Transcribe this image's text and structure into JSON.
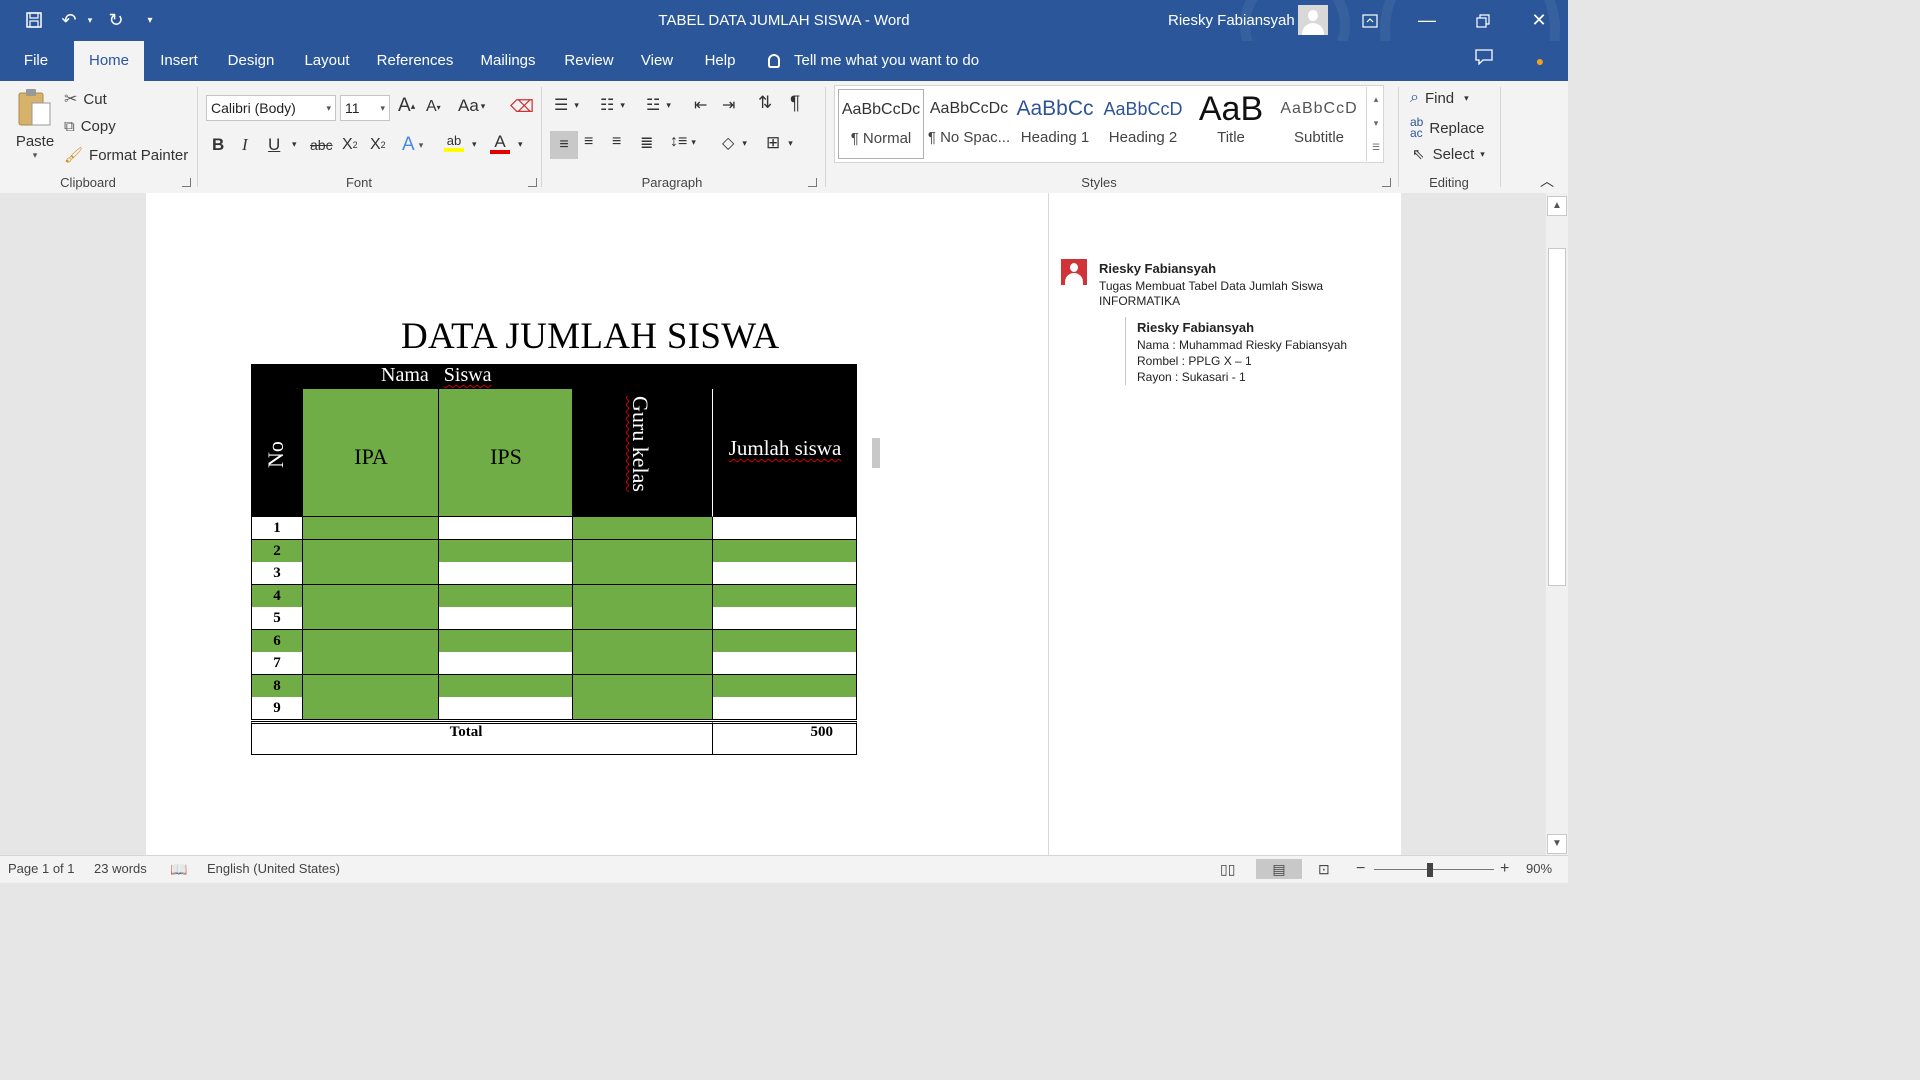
{
  "window": {
    "document_title": "TABEL DATA JUMLAH SISWA  -  Word",
    "user": "Riesky Fabiansyah"
  },
  "tabs": [
    "File",
    "Home",
    "Insert",
    "Design",
    "Layout",
    "References",
    "Mailings",
    "Review",
    "View",
    "Help"
  ],
  "active_tab": "Home",
  "tell_me": "Tell me what you want to do",
  "ribbon": {
    "clipboard": {
      "paste": "Paste",
      "cut": "Cut",
      "copy": "Copy",
      "format_painter": "Format Painter",
      "label": "Clipboard"
    },
    "font": {
      "font_name": "Calibri (Body)",
      "font_size": "11",
      "change_case": "Aa",
      "label": "Font",
      "bold": "B",
      "italic": "I",
      "underline": "U",
      "strikethrough": "abc",
      "subscript": "X2",
      "superscript": "X2",
      "text_effects": "A",
      "font_color": "A"
    },
    "paragraph": {
      "label": "Paragraph"
    },
    "styles": {
      "items": [
        {
          "preview": "AaBbCcDc",
          "name": "¶ Normal"
        },
        {
          "preview": "AaBbCcDc",
          "name": "¶ No Spac..."
        },
        {
          "preview": "AaBbCc",
          "name": "Heading 1"
        },
        {
          "preview": "AaBbCcD",
          "name": "Heading 2"
        },
        {
          "preview": "AaB",
          "name": "Title"
        },
        {
          "preview": "AaBbCcD",
          "name": "Subtitle"
        }
      ],
      "label": "Styles"
    },
    "editing": {
      "find": "Find",
      "replace": "Replace",
      "select": "Select",
      "label": "Editing"
    }
  },
  "document": {
    "heading": "DATA JUMLAH SISWA",
    "table": {
      "header_group": [
        "Nama",
        "Siswa"
      ],
      "col_no": "No",
      "col_ipa": "IPA",
      "col_ips": "IPS",
      "col_guru": "Guru kelas",
      "col_jumlah": "Jumlah siswa",
      "rows": [
        "1",
        "2",
        "3",
        "4",
        "5",
        "6",
        "7",
        "8",
        "9"
      ],
      "total_label": "Total",
      "total_value": "500"
    }
  },
  "comments": [
    {
      "author": "Riesky Fabiansyah",
      "lines": [
        "Tugas Membuat Tabel Data Jumlah Siswa",
        "INFORMATIKA"
      ]
    },
    {
      "author": "Riesky Fabiansyah",
      "lines": [
        "Nama : Muhammad Riesky Fabiansyah",
        "Rombel : PPLG X – 1",
        "Rayon : Sukasari - 1"
      ]
    }
  ],
  "status": {
    "page": "Page 1 of 1",
    "words": "23 words",
    "language": "English (United States)",
    "zoom": "90%"
  },
  "colors": {
    "ribbon_blue": "#2b579a",
    "table_green": "#70ad47",
    "comment_red": "#d13438"
  }
}
